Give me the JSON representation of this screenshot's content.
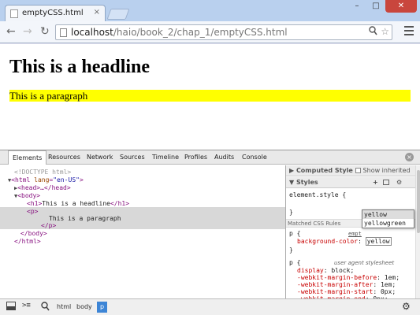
{
  "browser": {
    "tab_title": "emptyCSS.html",
    "tab_close": "×",
    "window_buttons": [
      "–",
      "□",
      "✕"
    ],
    "nav": {
      "back": "←",
      "forward": "→",
      "reload": "↻"
    },
    "url_host": "localhost",
    "url_path": "/haio/book_2/chap_1/emptyCSS.html",
    "zoom_icon": "magnifier-icon",
    "star_icon": "star-icon"
  },
  "page": {
    "headline": "This is a headline",
    "paragraph": "This is a paragraph",
    "paragraph_bg": "#ffff00"
  },
  "devtools": {
    "tabs": [
      "Elements",
      "Resources",
      "Network",
      "Sources",
      "Timeline",
      "Profiles",
      "Audits",
      "Console"
    ],
    "active_tab": "Elements",
    "close": "×",
    "dom": {
      "doctype": "<!DOCTYPE html>",
      "html_open_tag": "html",
      "html_attr": "lang",
      "html_attr_value": "\"en-US\"",
      "head": "<head>…</head>",
      "body_open": "<body>",
      "h1_open": "<h1>",
      "h1_text": "This is a headline",
      "h1_close": "</h1>",
      "p_open": "<p>",
      "p_text": "This is a paragraph",
      "p_close": "</p>",
      "body_close": "</body>",
      "html_close": "</html>"
    },
    "sidebar": {
      "computed_style": "Computed Style",
      "show_inherited": "Show inherited",
      "styles": "Styles",
      "element_style_open": "element.style {",
      "element_style_close": "}",
      "matched_rules": "Matched CSS Rules",
      "empty_link": "empt",
      "p_open": "p {",
      "bg_prop": "background-color",
      "bg_value": "yellow",
      "p_close": "}",
      "ua_selector": "p {",
      "ua_label": "user agent stylesheet",
      "ua_rules": [
        {
          "prop": "display",
          "value": "block;"
        },
        {
          "prop": "-webkit-margin-before",
          "value": "1em;"
        },
        {
          "prop": "-webkit-margin-after",
          "value": "1em;"
        },
        {
          "prop": "-webkit-margin-start",
          "value": "0px;"
        },
        {
          "prop": "-webkit-margin-end",
          "value": "0px;"
        }
      ]
    },
    "autocomplete": [
      "yellow",
      "yellowgreen"
    ],
    "breadcrumbs": [
      "html",
      "body",
      "p"
    ],
    "active_crumb": "p"
  }
}
